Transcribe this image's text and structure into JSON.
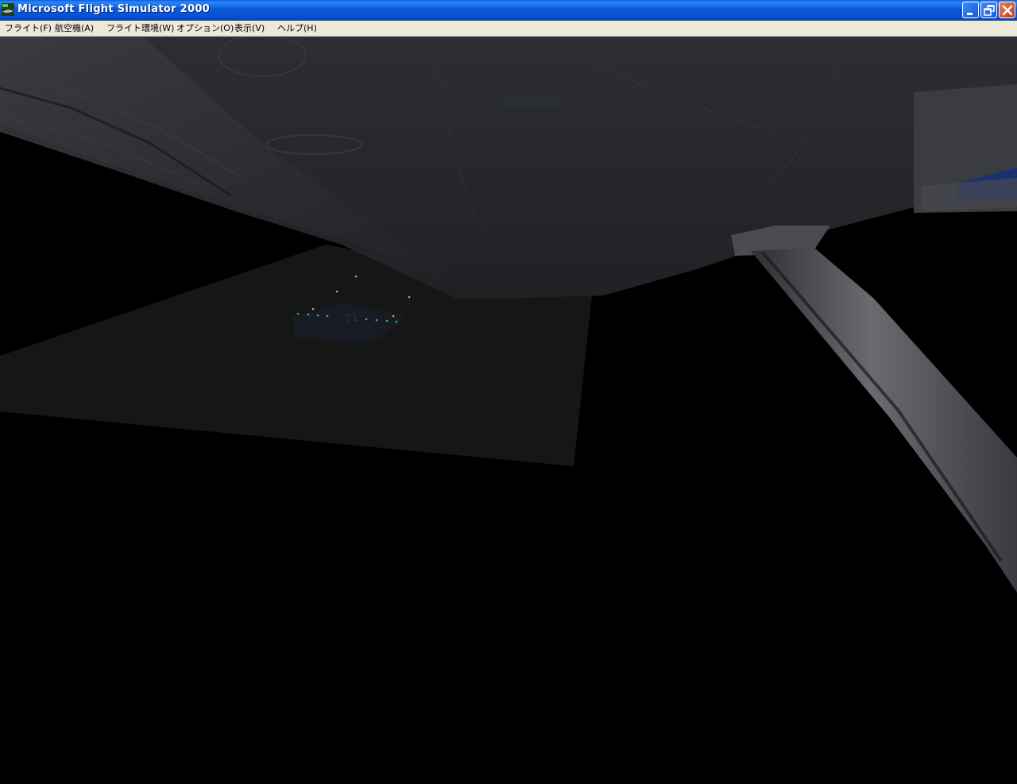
{
  "window": {
    "title": "Microsoft Flight Simulator 2000",
    "icon": "fs2000-app-icon",
    "controls": [
      "minimize-icon",
      "restore-icon",
      "close-icon"
    ]
  },
  "menubar": {
    "items": [
      {
        "label": "フライト(F)"
      },
      {
        "label": "航空機(A)"
      },
      {
        "label": "フライト環境(W)"
      },
      {
        "label": "オプション(O)"
      },
      {
        "label": "表示(V)"
      },
      {
        "label": "ヘルプ(H)"
      }
    ]
  },
  "scene": {
    "description_visible": false,
    "runway_number": "21",
    "colors": {
      "wing_underside": "#26282c",
      "strut": "#5a5a60",
      "ground": "#151716",
      "sky": "#000000",
      "runway": "#1a1c26",
      "light_green": "#1fc27a",
      "light_amber": "#e0a040"
    }
  }
}
